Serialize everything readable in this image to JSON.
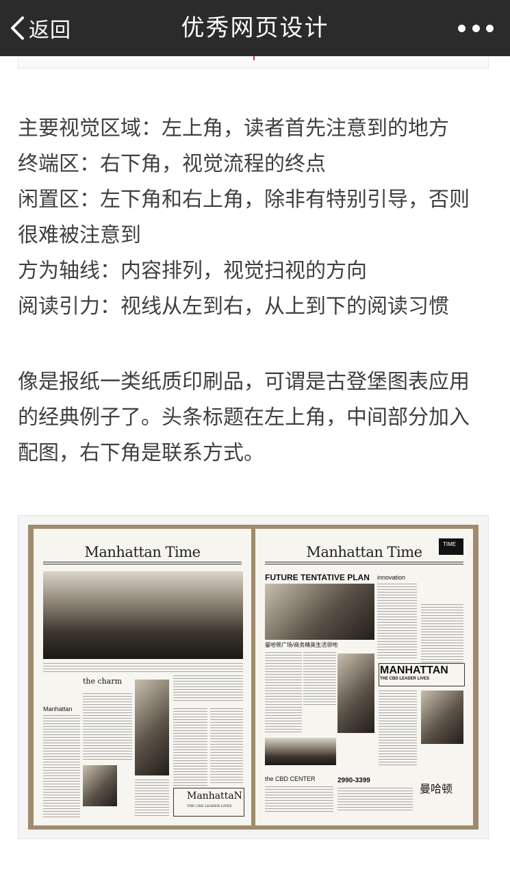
{
  "topbar": {
    "back_label": "返回",
    "title": "优秀网页设计",
    "back_icon": "chevron-left-icon",
    "more_icon": "more-dots-icon"
  },
  "article": {
    "paragraph1": [
      "主要视觉区域：左上角，读者首先注意到的地方",
      "终端区：右下角，视觉流程的终点",
      "闲置区：左下角和右上角，除非有特别引导，否则",
      "很难被注意到",
      "方为轴线：内容排列，视觉扫视的方向",
      "阅读引力：视线从左到右，从上到下的阅读习惯"
    ],
    "paragraph2": [
      "像是报纸一类纸质印刷品，可谓是古登堡图表应用",
      "的经典例子了。头条标题在左上角，中间部分加入",
      "配图，右下角是联系方式。"
    ]
  },
  "newspaper": {
    "masthead_left": "Manhattan Time",
    "masthead_right": "Manhattan Time",
    "left_headline": "the charm",
    "left_sub": "Manhattan",
    "left_logo": "ManhattaN",
    "left_logo_sub": "THE CBD LEADER LIVES",
    "right_headline": "FUTURE TENTATIVE PLAN",
    "right_innovation": "innovation",
    "right_caption": "曼哈顿广场/商务精英生活领地",
    "right_big": "MANHATTAN",
    "right_big_sub": "THE CBD LEADER LIVES",
    "right_cn_logo": "曼哈顿",
    "right_center": "the CBD CENTER",
    "right_tel": "2990-3399",
    "right_time_badge": "TIME"
  },
  "colors": {
    "topbar_bg": "#2b2b2b",
    "frame": "#a08b6e"
  }
}
